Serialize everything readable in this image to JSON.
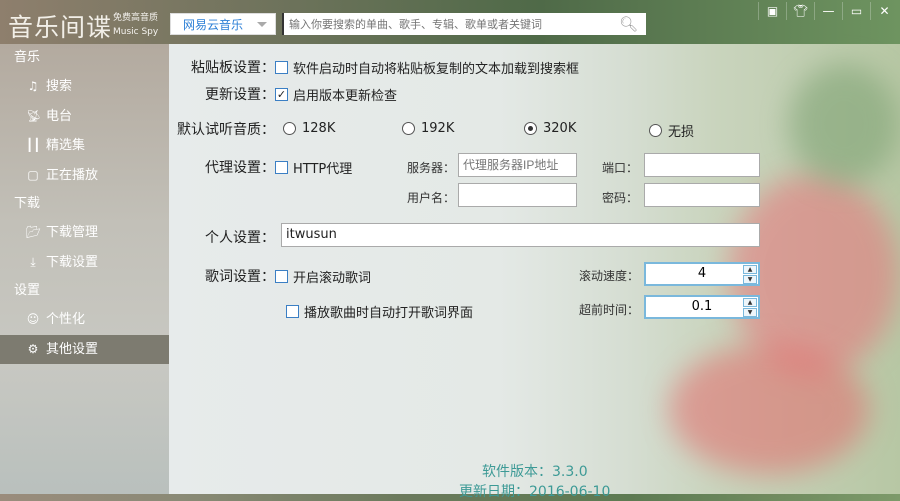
{
  "app": {
    "title": "音乐间谍",
    "subtitle_cn": "免费高音质",
    "subtitle_en": "Music Spy"
  },
  "header": {
    "source": "网易云音乐",
    "search_placeholder": "输入你要搜索的单曲、歌手、专辑、歌单或者关键词"
  },
  "sidebar": {
    "sections": [
      {
        "label": "音乐",
        "items": [
          {
            "label": "搜索",
            "icon": "music-note-icon"
          },
          {
            "label": "电台",
            "icon": "radio-icon"
          },
          {
            "label": "精选集",
            "icon": "bars-icon"
          },
          {
            "label": "正在播放",
            "icon": "play-screen-icon"
          }
        ]
      },
      {
        "label": "下载",
        "items": [
          {
            "label": "下载管理",
            "icon": "folder-icon"
          },
          {
            "label": "下载设置",
            "icon": "download-icon"
          }
        ]
      },
      {
        "label": "设置",
        "items": [
          {
            "label": "个性化",
            "icon": "user-icon"
          },
          {
            "label": "其他设置",
            "icon": "gear-icon"
          }
        ]
      }
    ],
    "active": "其他设置"
  },
  "settings": {
    "clipboard": {
      "label": "粘贴板设置：",
      "option": "软件启动时自动将粘贴板复制的文本加载到搜索框",
      "checked": false
    },
    "update": {
      "label": "更新设置：",
      "option": "启用版本更新检查",
      "checked": true
    },
    "quality": {
      "label": "默认试听音质：",
      "options": [
        "128K",
        "192K",
        "320K",
        "无损"
      ],
      "selected": "320K"
    },
    "proxy": {
      "label": "代理设置：",
      "option": "HTTP代理",
      "checked": false,
      "server_label": "服务器：",
      "server_placeholder": "代理服务器IP地址",
      "port_label": "端口：",
      "user_label": "用户名：",
      "password_label": "密码：",
      "server": "",
      "port": "",
      "user": "",
      "password": ""
    },
    "personal": {
      "label": "个人设置：",
      "value": "itwusun"
    },
    "lyrics": {
      "label": "歌词设置：",
      "scroll_option": "开启滚动歌词",
      "auto_option": "播放歌曲时自动打开歌词界面",
      "scroll_checked": false,
      "auto_checked": false,
      "speed_label": "滚动速度：",
      "speed": "4",
      "advance_label": "超前时间：",
      "advance": "0.1"
    }
  },
  "footer": {
    "version": "软件版本：3.3.0",
    "date": "更新日期：2016-06-10"
  }
}
